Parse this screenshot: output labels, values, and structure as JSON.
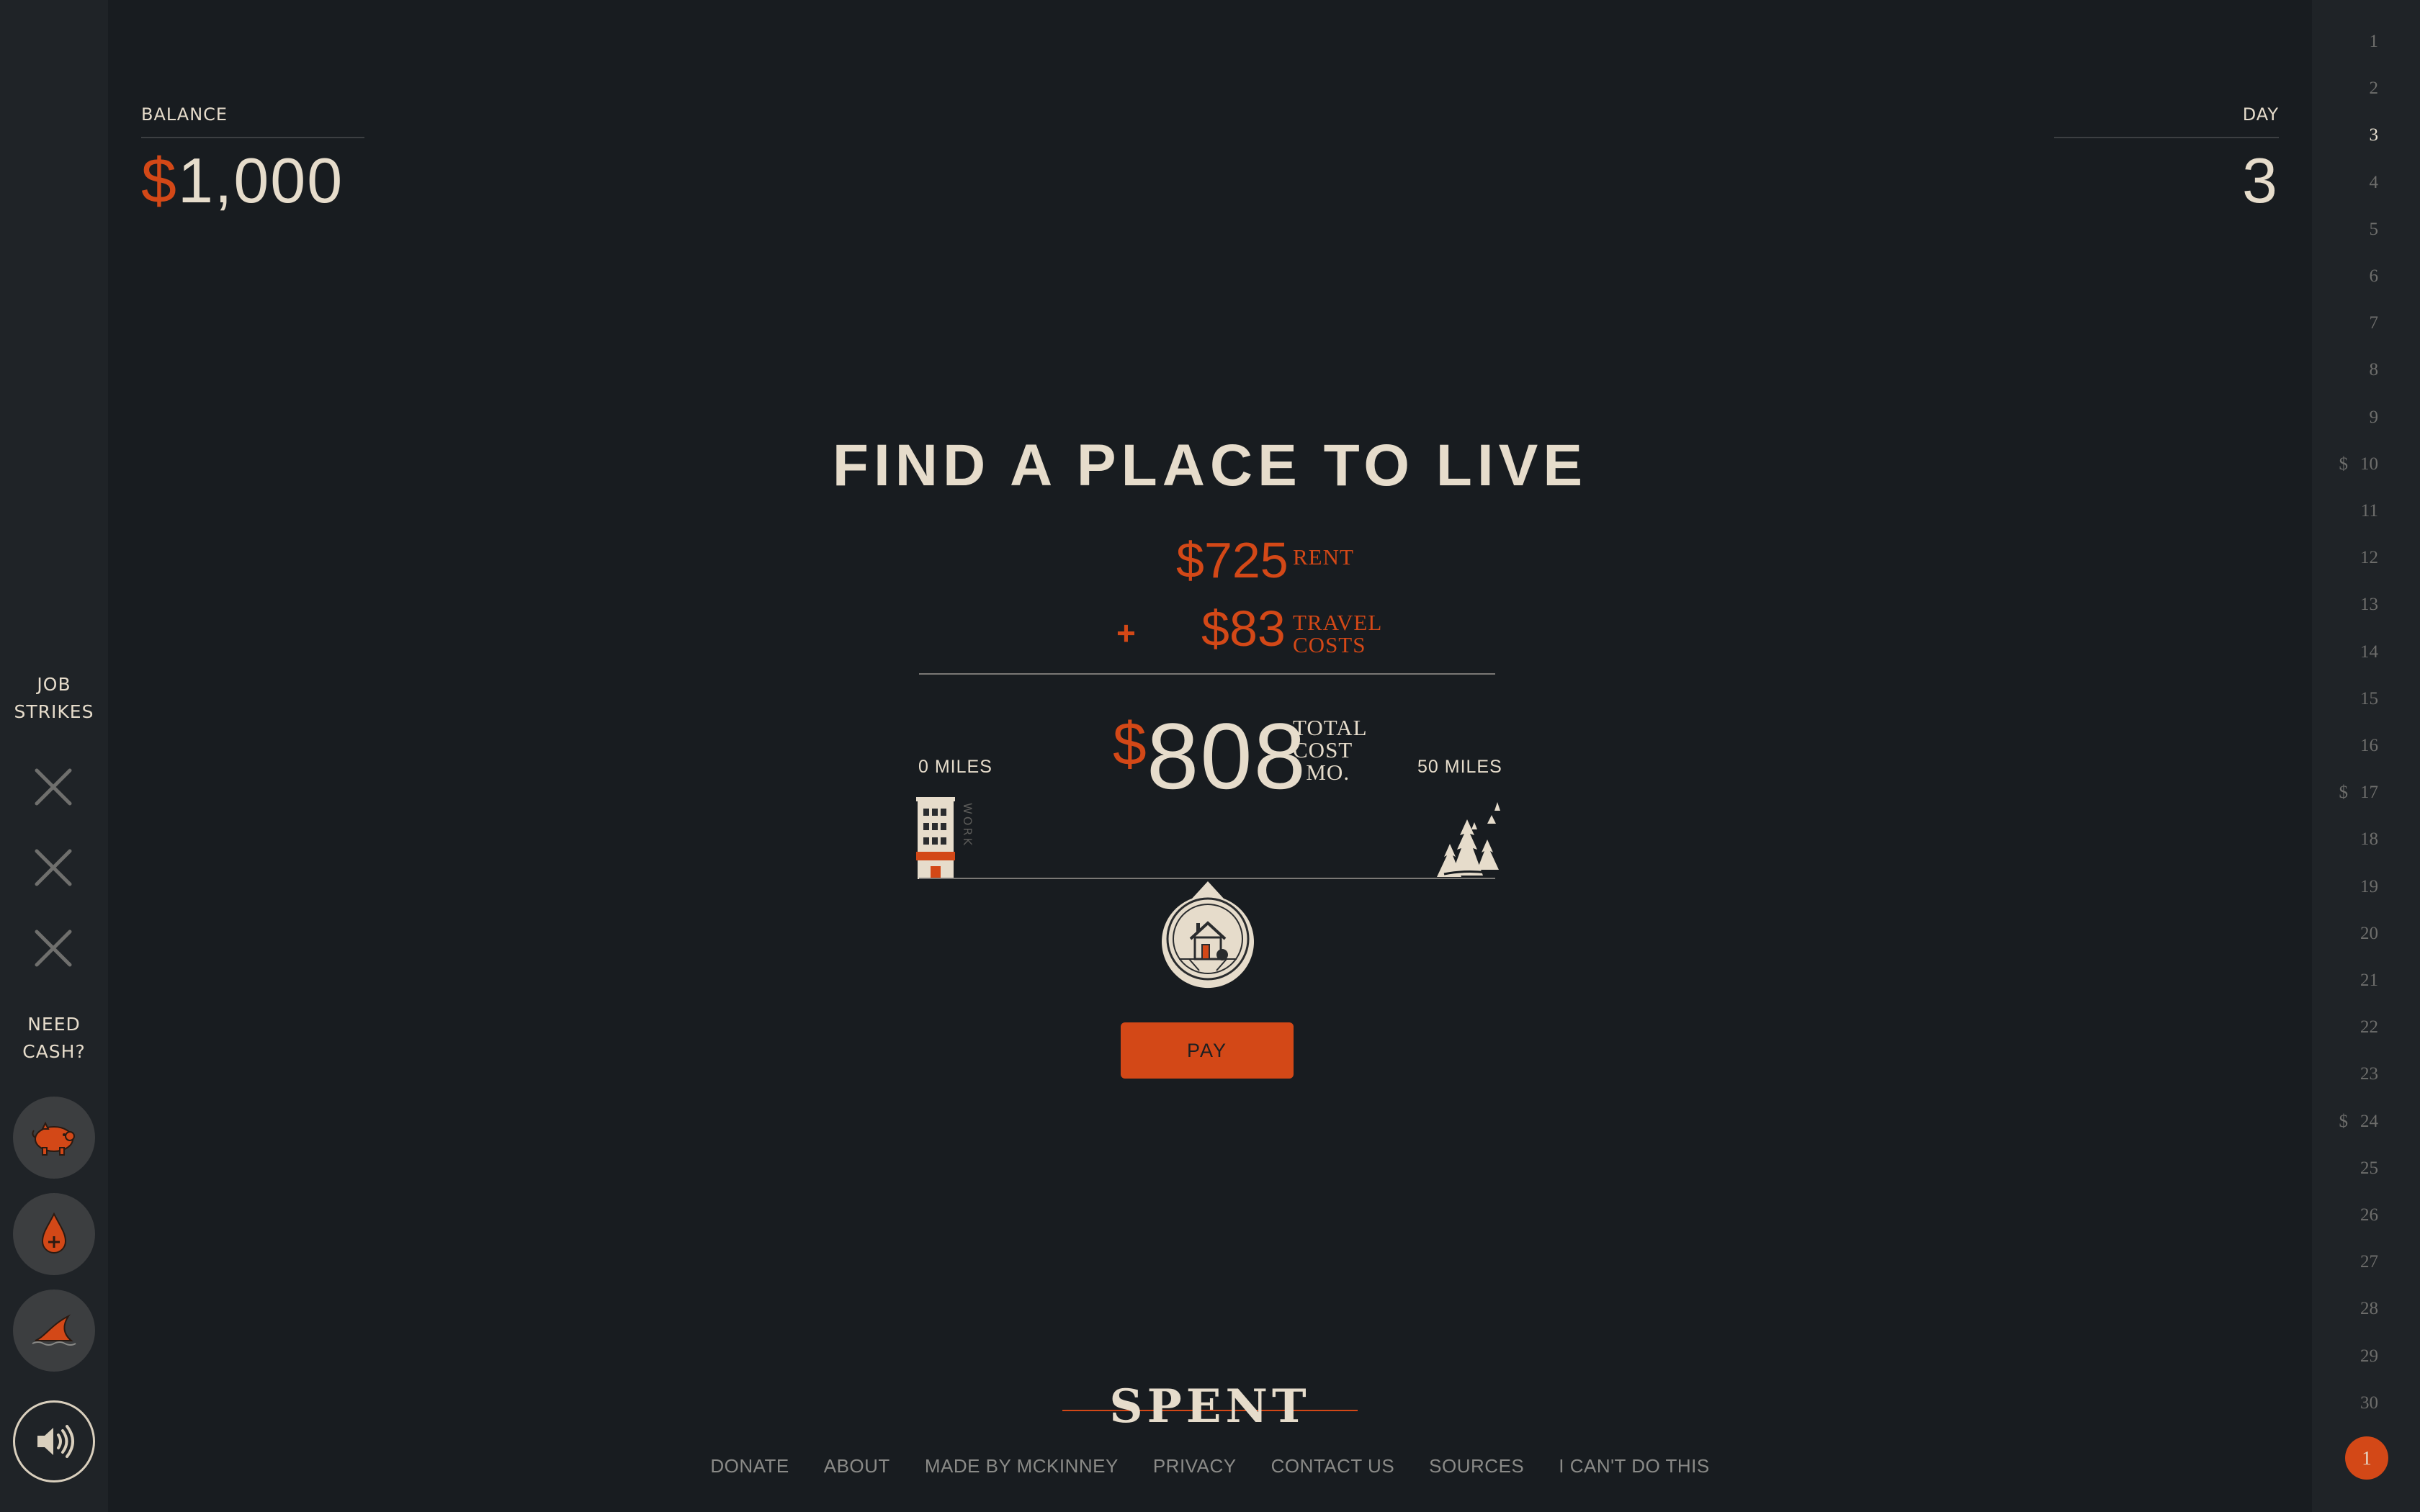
{
  "balance": {
    "label": "BALANCE",
    "currency": "$",
    "amount": "1,000"
  },
  "day": {
    "label": "DAY",
    "value": "3"
  },
  "sidebar": {
    "job_strikes_label_1": "JOB",
    "job_strikes_label_2": "STRIKES",
    "need_cash_label_1": "NEED",
    "need_cash_label_2": "CASH?",
    "strike_icons": [
      "close-icon",
      "close-icon",
      "close-icon"
    ],
    "cash_buttons": [
      "piggy-bank-icon",
      "blood-drop-icon",
      "shark-fin-icon"
    ],
    "sound_icon": "speaker-icon"
  },
  "main": {
    "title": "FIND A PLACE TO LIVE",
    "rent": {
      "currency": "$",
      "amount": "725",
      "label": "RENT"
    },
    "travel": {
      "plus": "+",
      "currency": "$",
      "amount": "83",
      "label_1": "TRAVEL",
      "label_2": "COSTS"
    },
    "total": {
      "currency": "$",
      "amount": "808",
      "label_1": "TOTAL",
      "label_2": "COST",
      "label_3": "/ MO."
    },
    "distance": {
      "min_label": "0 MILES",
      "max_label": "50 MILES",
      "work_label": "WORK"
    },
    "pay_label": "PAY"
  },
  "day_rail": {
    "days": [
      "1",
      "2",
      "3",
      "4",
      "5",
      "6",
      "7",
      "8",
      "9",
      "10",
      "11",
      "12",
      "13",
      "14",
      "15",
      "16",
      "17",
      "18",
      "19",
      "20",
      "21",
      "22",
      "23",
      "24",
      "25",
      "26",
      "27",
      "28",
      "29",
      "30"
    ],
    "payday_days": [
      "10",
      "17",
      "24"
    ],
    "payday_symbol": "$",
    "current_day": "3",
    "month_badge": "1"
  },
  "footer": {
    "logo": "SPENT",
    "links": [
      "DONATE",
      "ABOUT",
      "MADE BY MCKINNEY",
      "PRIVACY",
      "CONTACT US",
      "SOURCES",
      "I CAN'T DO THIS"
    ]
  },
  "colors": {
    "accent": "#d34817",
    "background": "#181c20",
    "text": "#e6dccb"
  }
}
